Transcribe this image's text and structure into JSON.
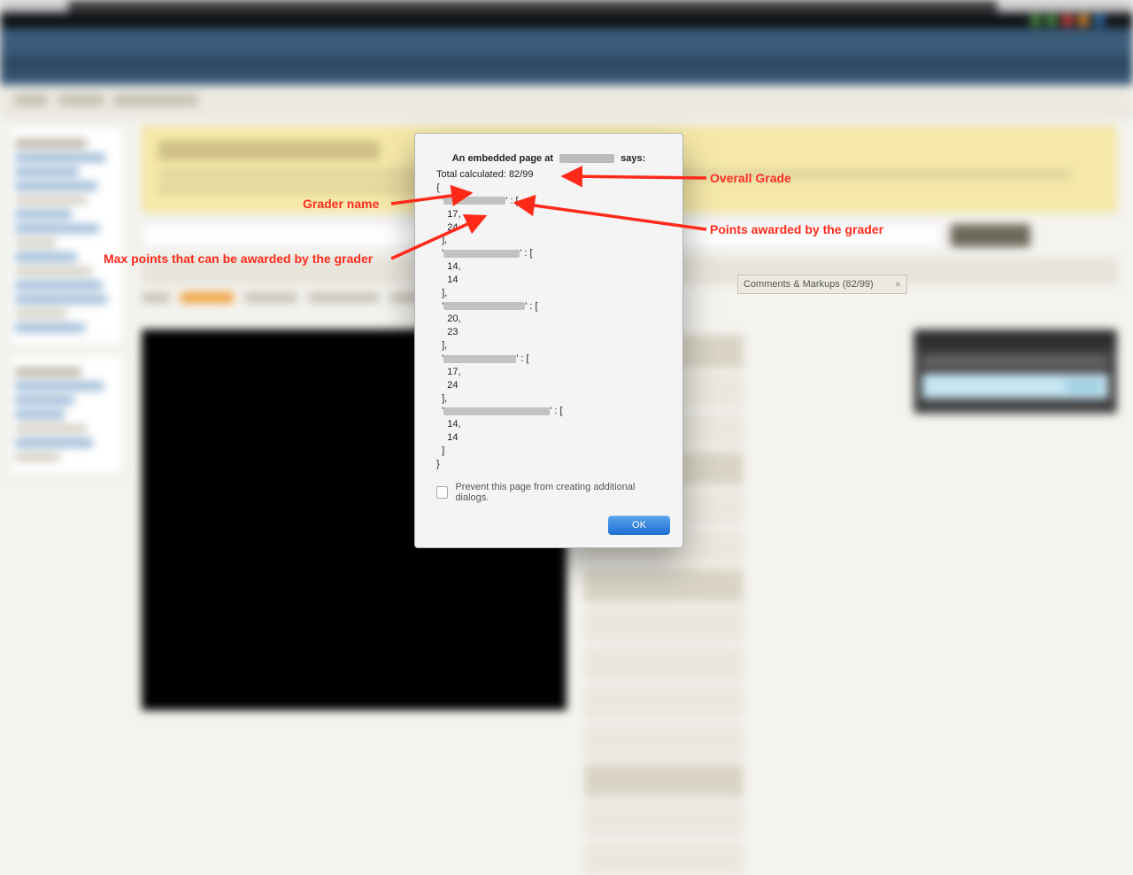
{
  "dialog": {
    "says_prefix": "An embedded page at ",
    "says_suffix": " says:",
    "total_prefix": "Total calculated: ",
    "total_value": "82/99",
    "graders": [
      {
        "points": 17,
        "max": 24
      },
      {
        "points": 14,
        "max": 14
      },
      {
        "points": 20,
        "max": 23
      },
      {
        "points": 17,
        "max": 24
      },
      {
        "points": 14,
        "max": 14
      }
    ],
    "prevent_label": "Prevent this page from creating additional dialogs.",
    "ok_label": "OK"
  },
  "comments_panel": {
    "label": "Comments & Markups (82/99)",
    "close": "×"
  },
  "annotations": {
    "overall": "Overall Grade",
    "grader_name": "Grader name",
    "points_awarded": "Points awarded by the grader",
    "max_points": "Max points that can be awarded by the grader"
  }
}
